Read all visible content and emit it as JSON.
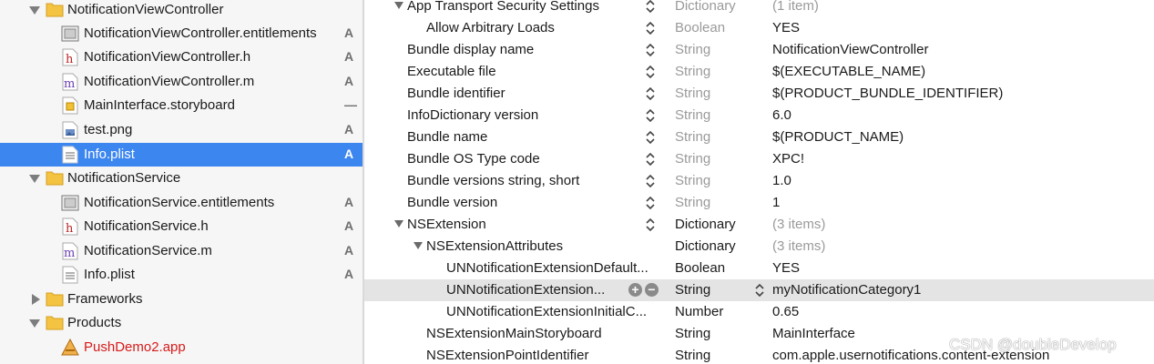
{
  "navigator": {
    "items": [
      {
        "label": "NotificationViewController",
        "kind": "folder",
        "expanded": true,
        "badge": ""
      },
      {
        "label": "NotificationViewController.entitlements",
        "kind": "entitlements",
        "badge": "A"
      },
      {
        "label": "NotificationViewController.h",
        "kind": "header",
        "icon_letter": "h",
        "badge": "A"
      },
      {
        "label": "NotificationViewController.m",
        "kind": "implementation",
        "icon_letter": "m",
        "badge": "A"
      },
      {
        "label": "MainInterface.storyboard",
        "kind": "storyboard",
        "badge": "—"
      },
      {
        "label": "test.png",
        "kind": "image",
        "badge": "A"
      },
      {
        "label": "Info.plist",
        "kind": "plist",
        "badge": "A",
        "selected": true
      },
      {
        "label": "NotificationService",
        "kind": "folder",
        "expanded": true,
        "badge": ""
      },
      {
        "label": "NotificationService.entitlements",
        "kind": "entitlements",
        "badge": "A"
      },
      {
        "label": "NotificationService.h",
        "kind": "header",
        "icon_letter": "h",
        "badge": "A"
      },
      {
        "label": "NotificationService.m",
        "kind": "implementation",
        "icon_letter": "m",
        "badge": "A"
      },
      {
        "label": "Info.plist",
        "kind": "plist",
        "badge": "A"
      },
      {
        "label": "Frameworks",
        "kind": "folder",
        "expanded": false,
        "badge": ""
      },
      {
        "label": "Products",
        "kind": "folder",
        "expanded": true,
        "badge": ""
      },
      {
        "label": "PushDemo2.app",
        "kind": "app",
        "badge": "",
        "color": "#d71a1a"
      }
    ]
  },
  "plist": {
    "rows": [
      {
        "key": "App Transport Security Settings",
        "type": "Dictionary",
        "value": "(1 item)",
        "expanded": true,
        "dim_type": true,
        "dim_value": true
      },
      {
        "key": "Allow Arbitrary Loads",
        "type": "Boolean",
        "value": "YES",
        "dim_type": true
      },
      {
        "key": "Bundle display name",
        "type": "String",
        "value": "NotificationViewController",
        "dim_type": true
      },
      {
        "key": "Executable file",
        "type": "String",
        "value": "$(EXECUTABLE_NAME)",
        "dim_type": true
      },
      {
        "key": "Bundle identifier",
        "type": "String",
        "value": "$(PRODUCT_BUNDLE_IDENTIFIER)",
        "dim_type": true
      },
      {
        "key": "InfoDictionary version",
        "type": "String",
        "value": "6.0",
        "dim_type": true
      },
      {
        "key": "Bundle name",
        "type": "String",
        "value": "$(PRODUCT_NAME)",
        "dim_type": true
      },
      {
        "key": "Bundle OS Type code",
        "type": "String",
        "value": "XPC!",
        "dim_type": true
      },
      {
        "key": "Bundle versions string, short",
        "type": "String",
        "value": "1.0",
        "dim_type": true
      },
      {
        "key": "Bundle version",
        "type": "String",
        "value": "1",
        "dim_type": true
      },
      {
        "key": "NSExtension",
        "type": "Dictionary",
        "value": "(3 items)",
        "expanded": true,
        "dim_value": true
      },
      {
        "key": "NSExtensionAttributes",
        "type": "Dictionary",
        "value": "(3 items)",
        "expanded": true,
        "dim_value": true
      },
      {
        "key": "UNNotificationExtensionDefault...",
        "type": "Boolean",
        "value": "YES"
      },
      {
        "key": "UNNotificationExtension...",
        "type": "String",
        "value": "myNotificationCategory1",
        "highlight": true
      },
      {
        "key": "UNNotificationExtensionInitialC...",
        "type": "Number",
        "value": "0.65"
      },
      {
        "key": "NSExtensionMainStoryboard",
        "type": "String",
        "value": "MainInterface"
      },
      {
        "key": "NSExtensionPointIdentifier",
        "type": "String",
        "value": "com.apple.usernotifications.content-extension"
      }
    ],
    "add_button": "+",
    "remove_button": "−"
  },
  "watermark": "CSDN @doubleDevelop"
}
